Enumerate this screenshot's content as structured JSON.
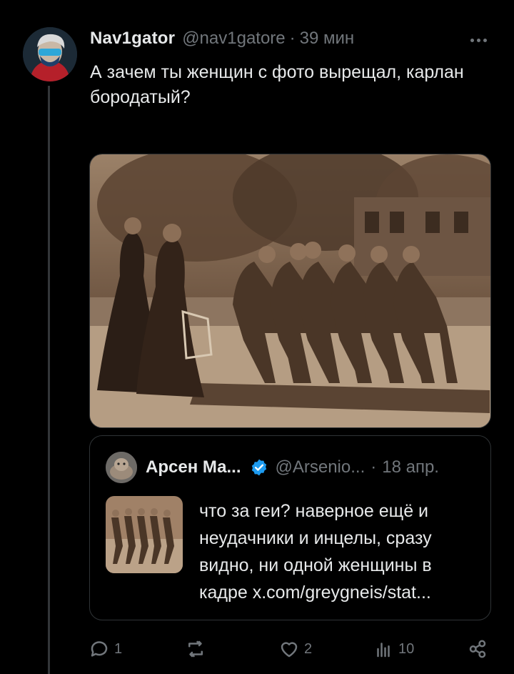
{
  "tweet": {
    "author_name": "Nav1gator",
    "author_handle": "@nav1gatore",
    "separator": "·",
    "time": "39 мин",
    "text": "А зачем ты женщин с фото вырещал, карлан бородатый?"
  },
  "quote": {
    "author_name": "Арсен Ма...",
    "author_handle": "@Arsenio...",
    "separator": "·",
    "time": "18 апр.",
    "text": "что за геи? наверное ещё и неудачники и инцелы, сразу видно, ни одной женщины в кадре  x.com/greygneis/stat..."
  },
  "actions": {
    "replies": "1",
    "reposts": "",
    "likes": "2",
    "views": "10"
  },
  "icons": [
    "avatar",
    "more-icon",
    "verified-badge-icon",
    "reply-icon",
    "repost-icon",
    "like-icon",
    "views-icon",
    "share-icon"
  ],
  "colors": {
    "background": "#000000",
    "text": "#e7e9ea",
    "muted": "#71767b",
    "border": "#2f3336",
    "verified": "#1d9bf0"
  }
}
